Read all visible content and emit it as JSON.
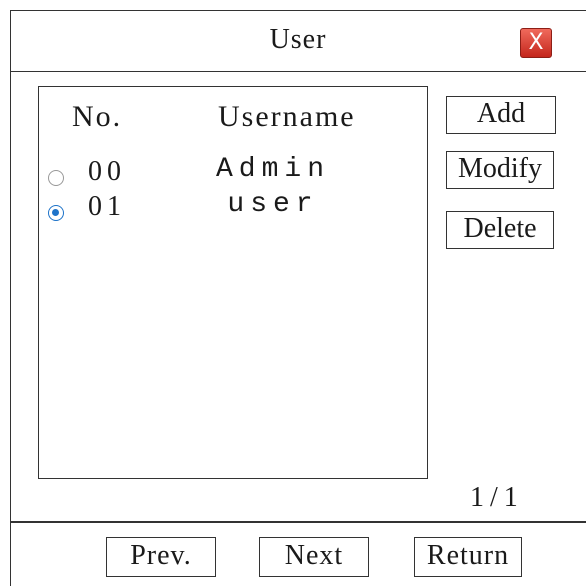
{
  "window": {
    "title": "User",
    "close_glyph": "X",
    "close_icon": "close-icon"
  },
  "table": {
    "headers": {
      "no": "No.",
      "username": "Username"
    },
    "rows": [
      {
        "no": "00",
        "username": "Admin",
        "selected": false
      },
      {
        "no": "01",
        "username": "user",
        "selected": true
      }
    ]
  },
  "actions": {
    "add": "Add",
    "modify": "Modify",
    "delete": "Delete"
  },
  "pagination": {
    "indicator": "1/1"
  },
  "nav": {
    "prev": "Prev.",
    "next": "Next",
    "return": "Return"
  },
  "colors": {
    "close_bg": "#d9362a",
    "radio_selected": "#1e73c9"
  }
}
